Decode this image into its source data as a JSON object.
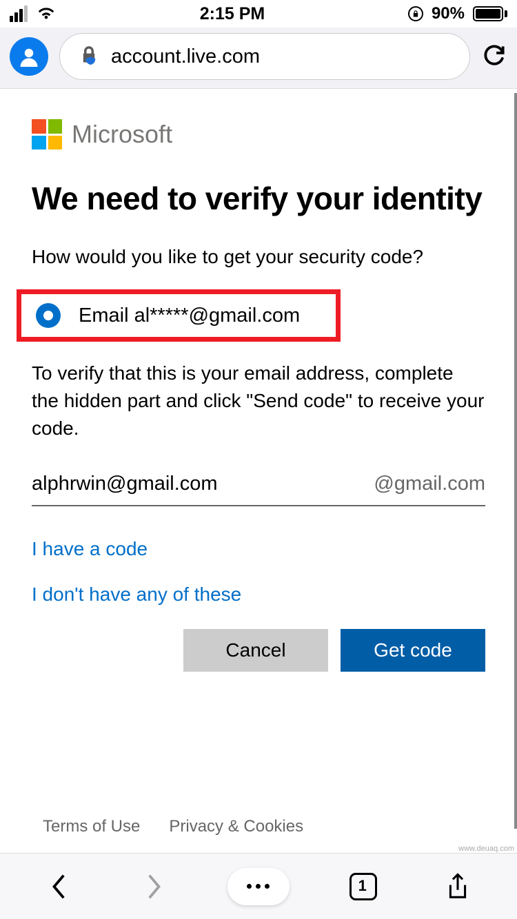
{
  "statusbar": {
    "time": "2:15 PM",
    "battery_pct": "90%"
  },
  "chrome": {
    "url": "account.live.com"
  },
  "page": {
    "brand": "Microsoft",
    "heading": "We need to verify your identity",
    "subhead": "How would you like to get your security code?",
    "radio_label": "Email al*****@gmail.com",
    "instruct": "To verify that this is your email address, complete the hidden part and click \"Send code\" to receive your code.",
    "email_value": "alphrwin@gmail.com",
    "email_suffix": "@gmail.com",
    "link_have_code": "I have a code",
    "link_none": "I don't have any of these",
    "btn_cancel": "Cancel",
    "btn_get_code": "Get code",
    "footer_terms": "Terms of Use",
    "footer_privacy": "Privacy & Cookies"
  },
  "toolbar": {
    "tab_count": "1"
  },
  "watermark": "www.deuaq.com"
}
